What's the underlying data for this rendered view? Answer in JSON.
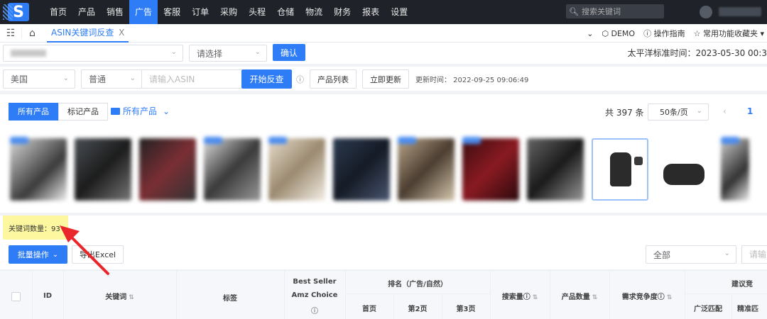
{
  "nav": {
    "logo": "S",
    "items": [
      "首页",
      "产品",
      "销售",
      "广告",
      "客服",
      "订单",
      "采购",
      "头程",
      "仓储",
      "物流",
      "财务",
      "报表",
      "设置"
    ],
    "active_index": 3,
    "search_placeholder": "搜索关键词"
  },
  "tabbar": {
    "tab_label": "ASIN关键词反查",
    "tab_close": "X",
    "demo": "DEMO",
    "guide": "操作指南",
    "favorites": "常用功能收藏夹"
  },
  "row1": {
    "select2_placeholder": "请选择",
    "confirm": "确认",
    "time": "太平洋标准时间：2023-05-30 00:3"
  },
  "row2": {
    "country": "美国",
    "mode": "普通",
    "asin_placeholder": "请输入ASIN",
    "start_button": "开始反查",
    "product_list": "产品列表",
    "update_now": "立即更新",
    "update_time": "更新时间：   2022-09-25 09:06:49"
  },
  "panel": {
    "seg_all": "所有产品",
    "seg_marked": "标记产品",
    "folder": "所有产品",
    "total": "共 397 条",
    "page_size": "50条/页",
    "page": "1"
  },
  "keywords": {
    "count_label": "关键词数量：93"
  },
  "actions": {
    "batch": "批量操作",
    "export": "导出Excel",
    "all": "全部",
    "search_partial": "请输"
  },
  "table": {
    "id": "ID",
    "keyword": "关键词",
    "tag": "标签",
    "best_seller": "Best Seller",
    "amz_choice": "Amz Choice",
    "rank_group": "排名（广告/自然）",
    "rank_p1": "首页",
    "rank_p2": "第2页",
    "rank_p3": "第3页",
    "search_volume": "搜索量",
    "product_count": "产品数量",
    "competition": "需求竞争度",
    "bid_group": "建议竞",
    "broad": "广泛匹配",
    "exact": "精准匹"
  },
  "colors": {
    "primary": "#2e7cf6",
    "nav_bg": "#1f2329",
    "highlight": "#fdf8a0",
    "arrow": "#e8262b"
  }
}
